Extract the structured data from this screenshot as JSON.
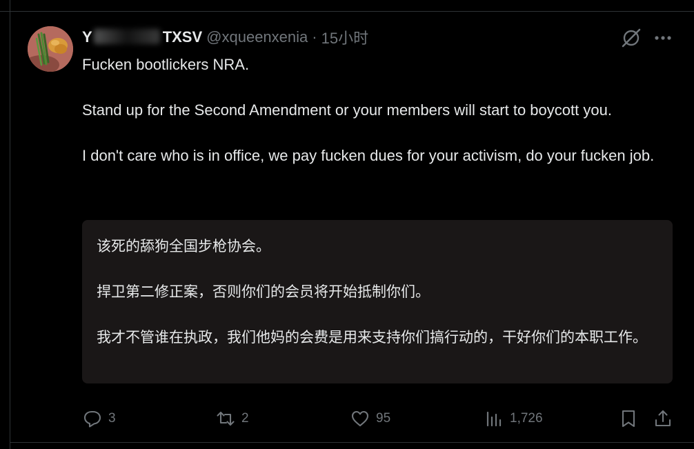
{
  "colors": {
    "background": "#000000",
    "text": "#e7e9ea",
    "muted": "#71767b",
    "translation_bg": "#1a1717",
    "divider": "#2f3336"
  },
  "post": {
    "author": {
      "display_name_first": "Y",
      "display_name_last": "TXSV",
      "handle": "@xqueenxenia",
      "separator": "·",
      "time": "15小时"
    },
    "body_paragraphs": [
      "Fucken bootlickers NRA.",
      "Stand up for the Second Amendment or your members will start to boycott you.",
      "I don't care who is in office, we pay fucken dues for your activism, do your fucken job."
    ],
    "translation_paragraphs": [
      "该死的舔狗全国步枪协会。",
      "捍卫第二修正案，否则你们的会员将开始抵制你们。",
      "我才不管谁在执政，我们他妈的会费是用来支持你们搞行动的，干好你们的本职工作。"
    ],
    "actions": {
      "replies": "3",
      "reposts": "2",
      "likes": "95",
      "views": "1,726"
    },
    "icons": {
      "grok": "grok-icon",
      "more": "more-icon",
      "reply": "reply-icon",
      "repost": "repost-icon",
      "like": "heart-icon",
      "views": "views-icon",
      "bookmark": "bookmark-icon",
      "share": "share-icon"
    }
  }
}
